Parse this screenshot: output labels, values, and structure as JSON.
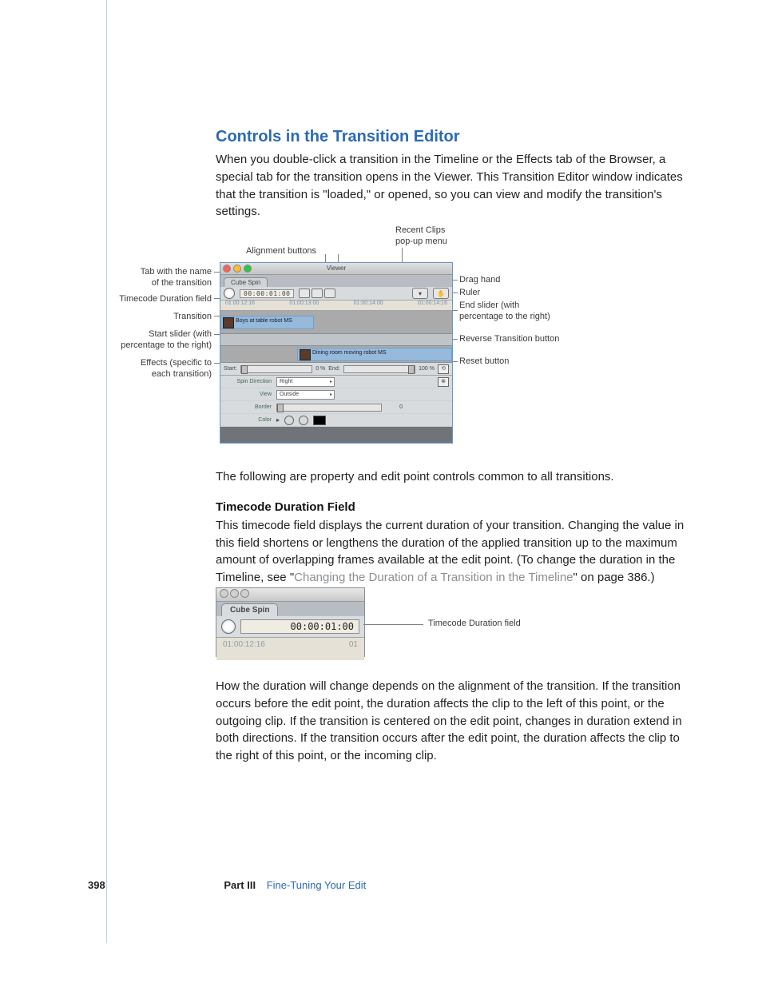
{
  "heading": "Controls in the Transition Editor",
  "intro": "When you double-click a transition in the Timeline or the Effects tab of the Browser, a special tab for the transition opens in the Viewer. This Transition Editor window indicates that the transition is \"loaded,\" or opened, so you can view and modify the transition's settings.",
  "following_line": "The following are property and edit point controls common to all transitions.",
  "subhead_tc": "Timecode Duration Field",
  "tc_para1_a": "This timecode field displays the current duration of your transition. Changing the value in this field shortens or lengthens the duration of the applied transition up to the maximum amount of overlapping frames available at the edit point. (To change the duration in the Timeline, see \"",
  "tc_para1_link": "Changing the Duration of a Transition in the Timeline",
  "tc_para1_b": "\" on page 386.)",
  "tc_para2": "How the duration will change depends on the alignment of the transition. If the transition occurs before the edit point, the duration affects the clip to the left of this point, or the outgoing clip. If the transition is centered on the edit point, changes in duration extend in both directions. If the transition occurs after the edit point, the duration affects the clip to the right of this point, or the incoming clip.",
  "callouts_left": {
    "tabname": "Tab with the name\nof the transition",
    "tcfield": "Timecode Duration field",
    "transition": "Transition",
    "startslider": "Start slider (with\npercentage to the right)",
    "effects": "Effects (specific to\neach transition)"
  },
  "callouts_top": {
    "alignment": "Alignment buttons",
    "recent": "Recent Clips\npop-up menu"
  },
  "callouts_right": {
    "drag": "Drag hand",
    "ruler": "Ruler",
    "endslider": "End slider (with\npercentage to the right)",
    "reverse": "Reverse Transition button",
    "reset": "Reset button"
  },
  "viewer": {
    "title": "Viewer",
    "tab": "Cube Spin",
    "timecode": "00:00:01:00",
    "ruler_ticks": [
      "01:00:12:16",
      "01:00:13:00",
      "01:00:14:00",
      "01:00:14:16"
    ],
    "clipA": "Boys at table robot MS",
    "clipB": "Dining room moving robot MS",
    "start_label": "Start:",
    "start_pct": "0 %",
    "end_label": "End:",
    "end_pct": "100 %",
    "params": {
      "spin": "Spin Direction",
      "spin_val": "Right",
      "view": "View",
      "view_val": "Outside",
      "border": "Border",
      "border_val": "0",
      "color": "Color"
    },
    "reverse_char": "⟲",
    "reset_char": "⊗"
  },
  "smallshot": {
    "tab": "Cube Spin",
    "timecode": "00:00:01:00",
    "ruler_a": "01:00:12:16",
    "ruler_b": "01",
    "callout": "Timecode Duration field"
  },
  "footer": {
    "page": "398",
    "part": "Part III",
    "title": "Fine-Tuning Your Edit"
  }
}
